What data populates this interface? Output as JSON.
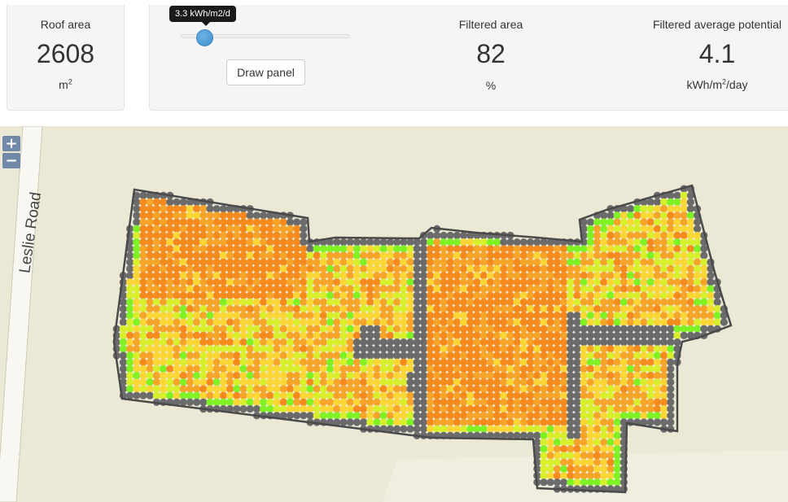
{
  "roof_area": {
    "label": "Roof area",
    "value": "2608",
    "unit_base": "m",
    "unit_sup": "2"
  },
  "slider": {
    "tooltip": "3.3 kWh/m2/d",
    "value": 3.3,
    "position_fraction": 0.14
  },
  "draw_panel_button": {
    "label": "Draw panel"
  },
  "filtered_area": {
    "label": "Filtered area",
    "value": "82",
    "unit": "%"
  },
  "filtered_potential": {
    "label": "Filtered average potential",
    "value": "4.1",
    "unit_pre": "kWh/m",
    "unit_sup": "2",
    "unit_post": "/day"
  },
  "map": {
    "road_name": "Leslie Road",
    "zoom_in": "+",
    "zoom_out": "−",
    "background_color": "#ebe8d6",
    "road_color": "#ffffff",
    "lot_color": "#f4f1e6",
    "outline_color": "#4a4a4a",
    "legend_colors": [
      "#f58a1f",
      "#f7a52a",
      "#fbd637",
      "#d8ef2e",
      "#7ff226",
      "#6b6b6b"
    ]
  }
}
